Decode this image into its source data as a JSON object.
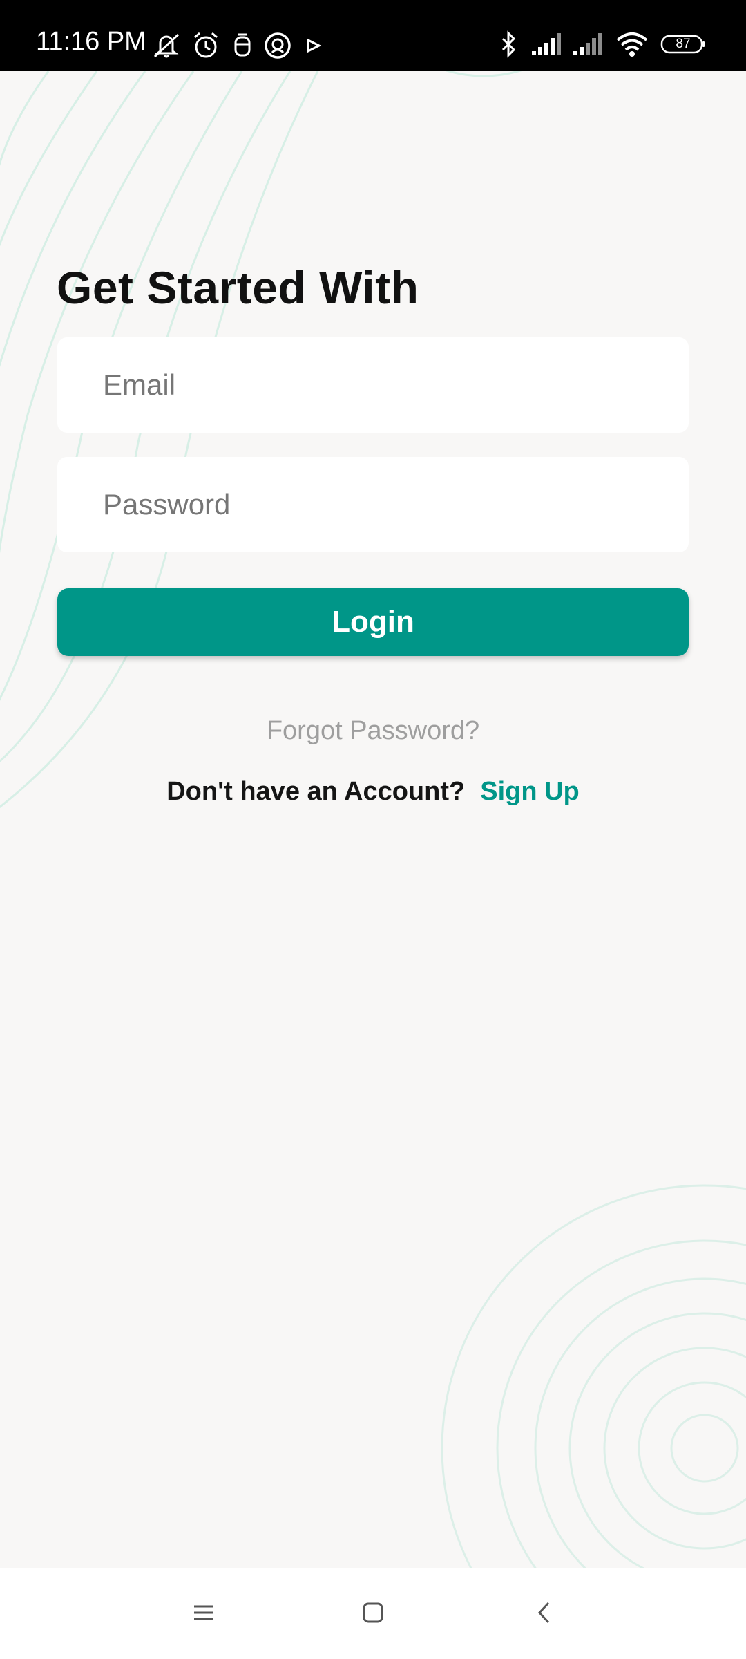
{
  "status_bar": {
    "time": "11:16 PM",
    "battery": "87",
    "icons_left": [
      "mute-icon",
      "alarm-icon",
      "notification-icon",
      "app-icon",
      "play-icon"
    ],
    "icons_right": [
      "bluetooth-icon",
      "signal-icon",
      "signal-icon",
      "wifi-icon",
      "battery-icon"
    ]
  },
  "login": {
    "title": "Get Started With",
    "email_placeholder": "Email",
    "password_placeholder": "Password",
    "login_label": "Login",
    "forgot_label": "Forgot Password?",
    "no_account_text": "Don't have an Account?",
    "signup_label": "Sign Up"
  },
  "colors": {
    "accent": "#009688",
    "background": "#f8f7f6",
    "decor_lines": "#d9efe8"
  },
  "nav_bar": {
    "items": [
      "menu-icon",
      "home-icon",
      "back-icon"
    ]
  }
}
